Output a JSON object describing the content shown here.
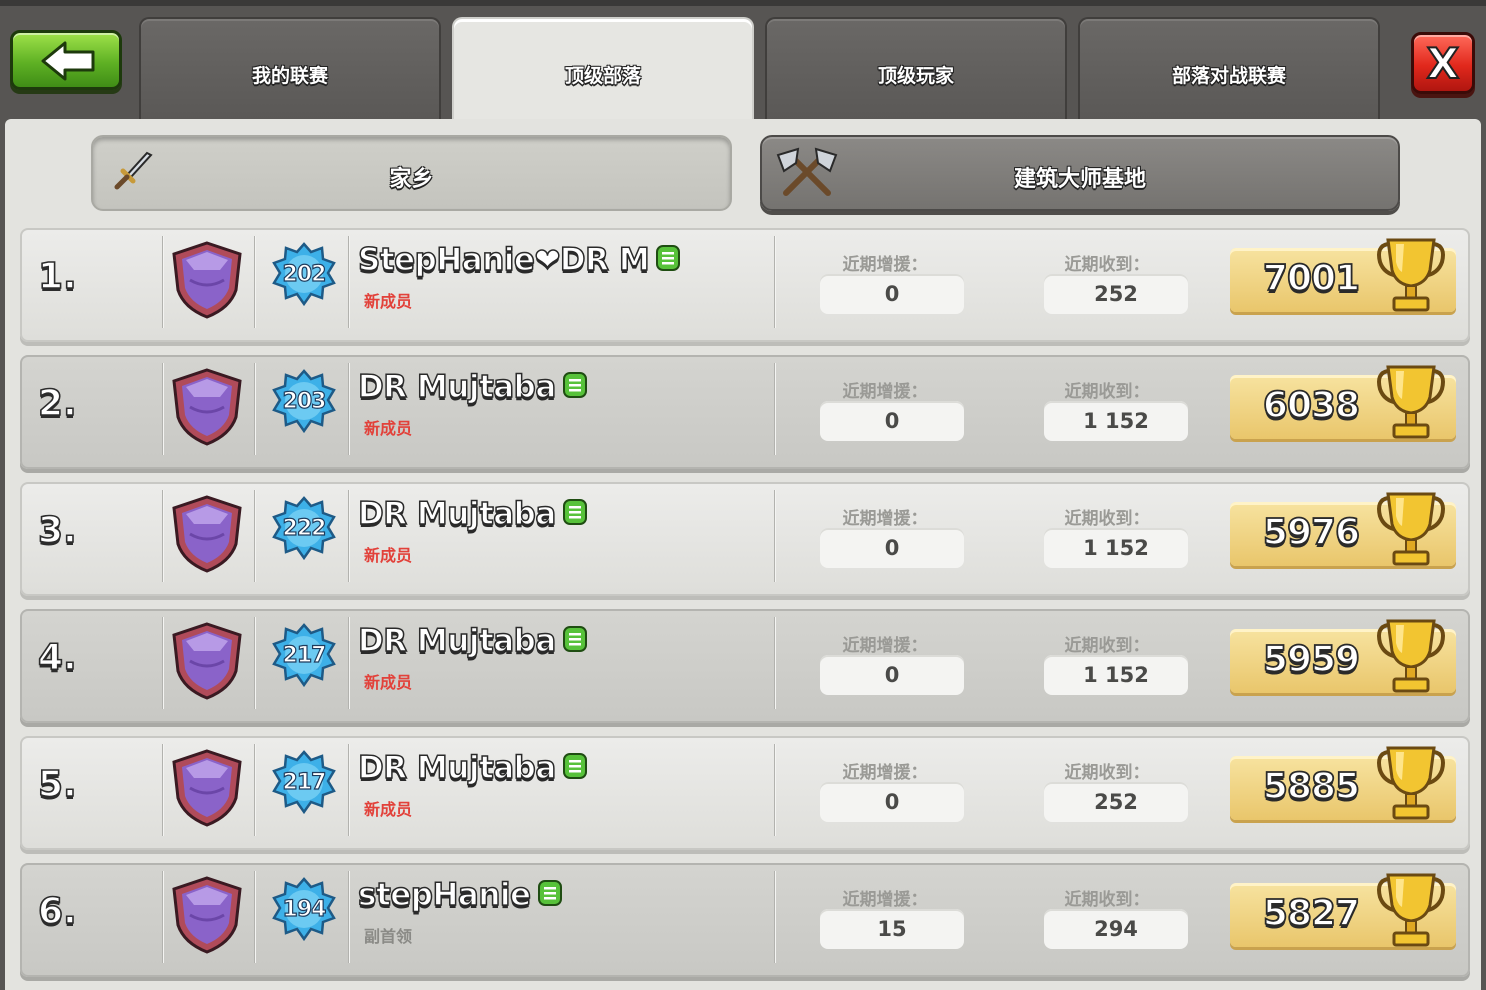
{
  "colors": {
    "accent_green": "#5fb124",
    "close_red": "#e1281c",
    "trophy_gold": "#e9c66b",
    "role_new": "#e2413a"
  },
  "tabs": [
    {
      "label": "我的联赛",
      "active": false
    },
    {
      "label": "顶级部落",
      "active": true
    },
    {
      "label": "顶级玩家",
      "active": false
    },
    {
      "label": "部落对战联赛",
      "active": false
    }
  ],
  "subtabs": {
    "home": "家乡",
    "builder": "建筑大师基地"
  },
  "stat_labels": {
    "donated": "近期增援：",
    "received": "近期收到："
  },
  "rows": [
    {
      "rank": "1.",
      "level": "202",
      "name": "StepHanie❤DR M",
      "role": "新成员",
      "donated": "0",
      "received": "252",
      "trophies": "7001"
    },
    {
      "rank": "2.",
      "level": "203",
      "name": "DR Mujtaba",
      "role": "新成员",
      "donated": "0",
      "received": "1 152",
      "trophies": "6038"
    },
    {
      "rank": "3.",
      "level": "222",
      "name": "DR Mujtaba",
      "role": "新成员",
      "donated": "0",
      "received": "1 152",
      "trophies": "5976"
    },
    {
      "rank": "4.",
      "level": "217",
      "name": "DR Mujtaba",
      "role": "新成员",
      "donated": "0",
      "received": "1 152",
      "trophies": "5959"
    },
    {
      "rank": "5.",
      "level": "217",
      "name": "DR Mujtaba",
      "role": "新成员",
      "donated": "0",
      "received": "252",
      "trophies": "5885"
    },
    {
      "rank": "6.",
      "level": "194",
      "name": "stepHanie",
      "role": "副首领",
      "donated": "15",
      "received": "294",
      "trophies": "5827"
    }
  ]
}
